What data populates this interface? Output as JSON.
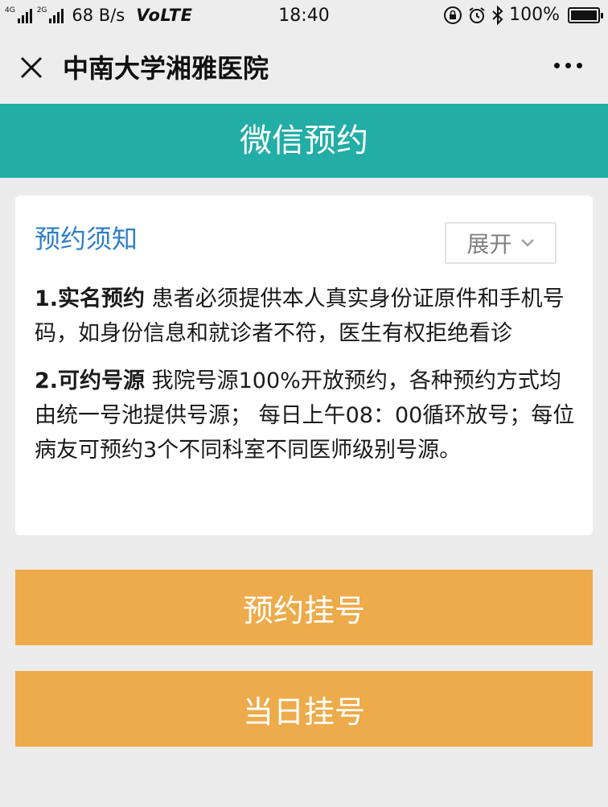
{
  "status_bar": {
    "network_tag_1": "4G",
    "network_tag_2": "2G",
    "speed": "68 B/s",
    "volte": "VoLTE",
    "time": "18:40",
    "battery": "100%",
    "battery_level": 1.0,
    "icons": [
      "lock-rotation-icon",
      "alarm-icon",
      "bluetooth-icon",
      "battery-icon"
    ]
  },
  "header": {
    "title": "中南大学湘雅医院",
    "close_icon": "close-icon",
    "more_icon": "more-icon"
  },
  "banner": {
    "title": "微信预约",
    "color": "#22ada6"
  },
  "notice": {
    "title": "预约须知",
    "expand_label": "展开",
    "items": [
      {
        "heading": "1.实名预约",
        "text": " 患者必须提供本人真实身份证原件和手机号码，如身份信息和就诊者不符，医生有权拒绝看诊"
      },
      {
        "heading": "2.可约号源",
        "text": " 我院号源100%开放预约，各种预约方式均由统一号池提供号源； 每日上午08：00循环放号；每位病友可预约3个不同科室不同医师级别号源。"
      }
    ]
  },
  "actions": {
    "book_label": "预约挂号",
    "same_day_label": "当日挂号",
    "color": "#edab4b"
  }
}
